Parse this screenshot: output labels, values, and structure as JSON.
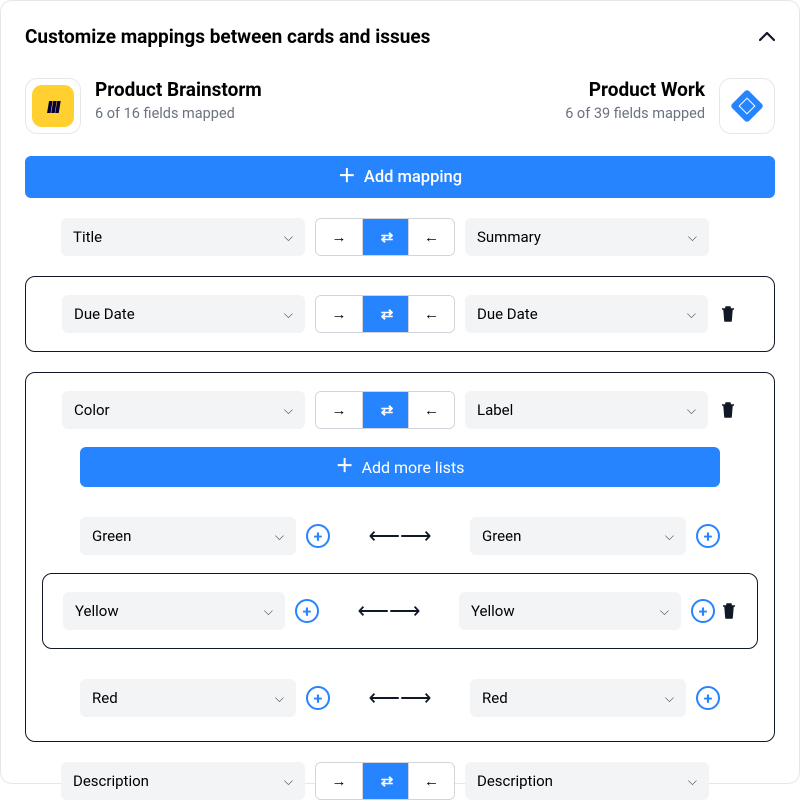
{
  "header": {
    "title": "Customize mappings between cards and issues"
  },
  "left_app": {
    "name": "Product Brainstorm",
    "sub": "6 of 16 fields mapped"
  },
  "right_app": {
    "name": "Product Work",
    "sub": "6 of 39 fields mapped"
  },
  "add_mapping_label": "Add mapping",
  "add_more_lists_label": "Add more lists",
  "mappings": {
    "title": {
      "left": "Title",
      "right": "Summary"
    },
    "due": {
      "left": "Due Date",
      "right": "Due Date"
    },
    "color": {
      "left": "Color",
      "right": "Label"
    },
    "desc": {
      "left": "Description",
      "right": "Description"
    }
  },
  "lists": {
    "green": {
      "left": "Green",
      "right": "Green"
    },
    "yellow": {
      "left": "Yellow",
      "right": "Yellow"
    },
    "red": {
      "left": "Red",
      "right": "Red"
    }
  }
}
